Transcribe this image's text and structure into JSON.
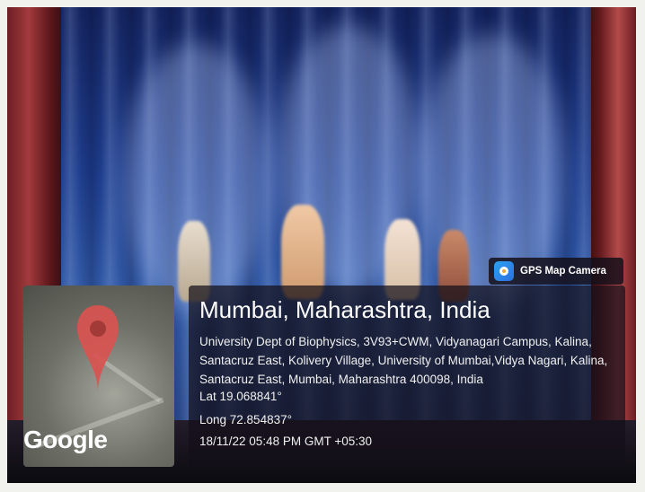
{
  "badge": {
    "label": "GPS Map Camera",
    "icon": "camera-pin-icon"
  },
  "map": {
    "provider": "Google",
    "icon": "map-pin-icon"
  },
  "location": {
    "title": "Mumbai, Maharashtra, India",
    "address": "University Dept of Biophysics, 3V93+CWM, Vidyanagari Campus, Kalina, Santacruz East, Kolivery Village, University of Mumbai,Vidya Nagari, Kalina, Santacruz East, Mumbai, Maharashtra 400098, India",
    "lat": "Lat 19.068841°",
    "long": "Long 72.854837°",
    "datetime": "18/11/22 05:48 PM GMT +05:30"
  },
  "colors": {
    "curtain_blue": "#1e3d8c",
    "curtain_red": "#a13a3d",
    "overlay": "#140f19",
    "pin_red": "#d9534f"
  }
}
